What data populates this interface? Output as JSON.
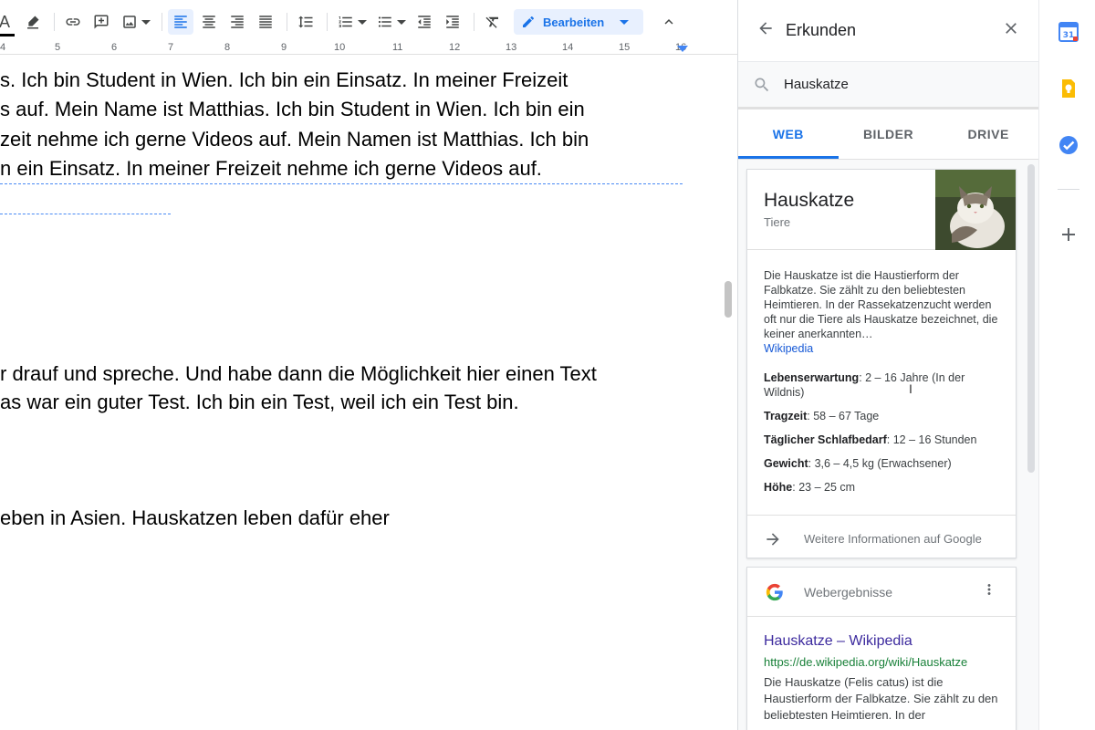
{
  "toolbar": {
    "mode_label": "Bearbeiten"
  },
  "ruler": {
    "labels": [
      "4",
      "5",
      "6",
      "7",
      "8",
      "9",
      "10",
      "11",
      "12",
      "13",
      "14",
      "15",
      "16"
    ]
  },
  "document": {
    "lines": [
      "s. Ich bin Student in Wien. Ich bin ein Einsatz. In meiner Freizeit",
      "s auf. Mein Name ist Matthias. Ich bin Student in Wien. Ich bin ein",
      "zeit nehme ich gerne Videos auf. Mein Namen ist Matthias. Ich bin",
      "n ein Einsatz. In meiner Freizeit nehme ich gerne Videos auf.",
      "r drauf und spreche. Und habe dann die Möglichkeit hier einen Text",
      "as war ein guter Test. Ich bin ein Test, weil ich ein Test bin.",
      "eben in Asien. Hauskatzen leben dafür eher"
    ]
  },
  "explore": {
    "title": "Erkunden",
    "search_value": "Hauskatze",
    "tabs": [
      "WEB",
      "BILDER",
      "DRIVE"
    ],
    "active_tab": "WEB",
    "knowledge_card": {
      "title": "Hauskatze",
      "subtitle": "Tiere",
      "description": "Die Hauskatze ist die Haustierform der Falbkatze. Sie zählt zu den beliebtesten Heimtieren. In der Rassekatzenzucht werden oft nur die Tiere als Hauskatze bezeichnet, die keiner anerkannten…",
      "source": "Wikipedia",
      "facts": [
        {
          "label": "Lebenserwartung",
          "value": ": 2 – 16 Jahre (In der Wildnis)"
        },
        {
          "label": "Tragzeit",
          "value": ": 58 – 67 Tage"
        },
        {
          "label": "Täglicher Schlafbedarf",
          "value": ": 12 – 16 Stunden"
        },
        {
          "label": "Gewicht",
          "value": ": 3,6 – 4,5 kg (Erwachsener)"
        },
        {
          "label": "Höhe",
          "value": ": 23 – 25 cm"
        }
      ],
      "more_label": "Weitere Informationen auf Google"
    },
    "web_results": {
      "header": "Webergebnisse",
      "result": {
        "title": "Hauskatze – Wikipedia",
        "url": "https://de.wikipedia.org/wiki/Hauskatze",
        "snippet": "Die Hauskatze (Felis catus) ist die Haustierform der Falbkatze. Sie zählt zu den beliebtesten Heimtieren. In der"
      }
    }
  },
  "colors": {
    "accent": "#1a73e8",
    "link": "#1558d6",
    "result_title": "#3c2a9e",
    "result_url": "#188038"
  }
}
